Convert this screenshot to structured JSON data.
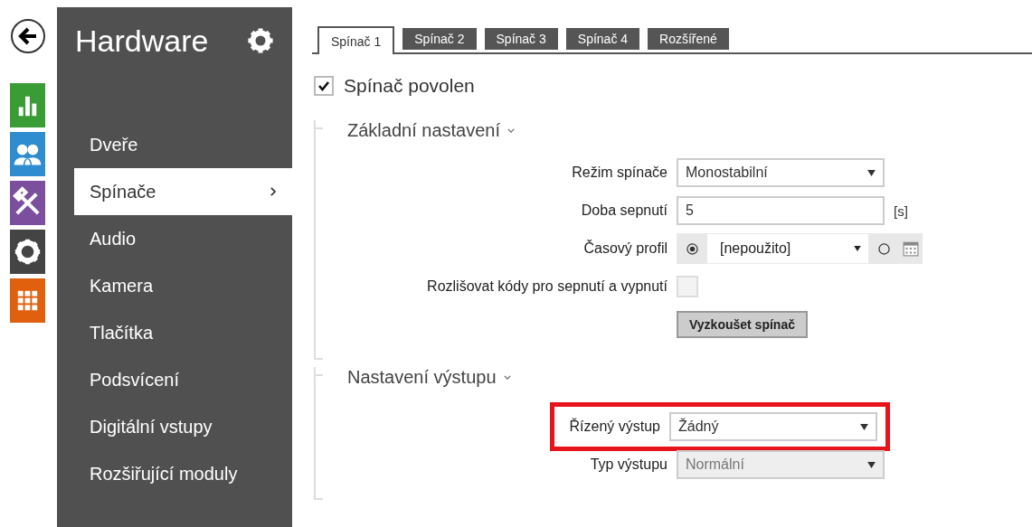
{
  "sidebar": {
    "title": "Hardware",
    "items": [
      {
        "label": "Dveře",
        "selected": false
      },
      {
        "label": "Spínače",
        "selected": true
      },
      {
        "label": "Audio",
        "selected": false
      },
      {
        "label": "Kamera",
        "selected": false
      },
      {
        "label": "Tlačítka",
        "selected": false
      },
      {
        "label": "Podsvícení",
        "selected": false
      },
      {
        "label": "Digitální vstupy",
        "selected": false
      },
      {
        "label": "Rozšiřující moduly",
        "selected": false
      }
    ]
  },
  "tabs": [
    {
      "label": "Spínač 1",
      "selected": true
    },
    {
      "label": "Spínač 2",
      "selected": false
    },
    {
      "label": "Spínač 3",
      "selected": false
    },
    {
      "label": "Spínač 4",
      "selected": false
    },
    {
      "label": "Rozšířené",
      "selected": false
    }
  ],
  "enable_checkbox": {
    "label": "Spínač povolen",
    "checked": true
  },
  "sections": [
    {
      "title": "Základní nastavení",
      "fields": [
        {
          "kind": "select",
          "label": "Režim spínače",
          "value": "Monostabilní",
          "disabled": false,
          "highlighted": false
        },
        {
          "kind": "text",
          "label": "Doba sepnutí",
          "value": "5",
          "unit": "[s]",
          "highlighted": false
        },
        {
          "kind": "profile",
          "label": "Časový profil",
          "value": "[nepoužito]",
          "radios": [
            {
              "selected": true
            },
            {
              "selected": false
            }
          ],
          "highlighted": false
        },
        {
          "kind": "checkbox",
          "label": "Rozlišovat kódy pro sepnutí a vypnutí",
          "checked": false,
          "highlighted": false
        },
        {
          "kind": "button",
          "label": "Vyzkoušet spínač",
          "highlighted": false
        }
      ]
    },
    {
      "title": "Nastavení výstupu",
      "fields": [
        {
          "kind": "select",
          "label": "Řízený výstup",
          "value": "Žádný",
          "disabled": false,
          "highlighted": true
        },
        {
          "kind": "select",
          "label": "Typ výstupu",
          "value": "Normální",
          "disabled": true,
          "highlighted": false
        }
      ]
    }
  ]
}
